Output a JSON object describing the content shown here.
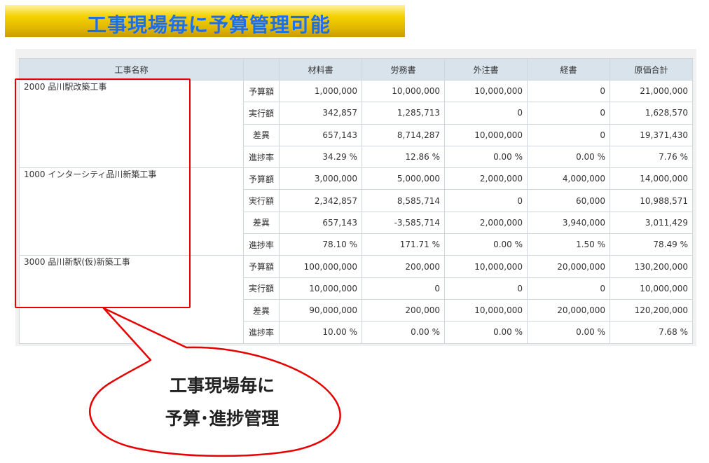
{
  "banner": {
    "title": "工事現場毎に予算管理可能"
  },
  "table": {
    "headers": [
      "工事名称",
      "",
      "材料書",
      "労務書",
      "外注書",
      "経書",
      "原価合計"
    ],
    "sites": [
      {
        "name": "2000 品川駅改築工事",
        "rows": [
          {
            "label": "予算額",
            "values": [
              "1,000,000",
              "10,000,000",
              "10,000,000",
              "0",
              "21,000,000"
            ]
          },
          {
            "label": "実行額",
            "values": [
              "342,857",
              "1,285,713",
              "0",
              "0",
              "1,628,570"
            ]
          },
          {
            "label": "差異",
            "values": [
              "657,143",
              "8,714,287",
              "10,000,000",
              "0",
              "19,371,430"
            ]
          },
          {
            "label": "進捗率",
            "values": [
              "34.29 %",
              "12.86 %",
              "0.00 %",
              "0.00 %",
              "7.76 %"
            ]
          }
        ]
      },
      {
        "name": "1000 インターシティ品川新築工事",
        "rows": [
          {
            "label": "予算額",
            "values": [
              "3,000,000",
              "5,000,000",
              "2,000,000",
              "4,000,000",
              "14,000,000"
            ]
          },
          {
            "label": "実行額",
            "values": [
              "2,342,857",
              "8,585,714",
              "0",
              "60,000",
              "10,988,571"
            ]
          },
          {
            "label": "差異",
            "values": [
              "657,143",
              "-3,585,714",
              "2,000,000",
              "3,940,000",
              "3,011,429"
            ]
          },
          {
            "label": "進捗率",
            "values": [
              "78.10 %",
              "171.71 %",
              "0.00 %",
              "1.50 %",
              "78.49 %"
            ]
          }
        ]
      },
      {
        "name": "3000 品川新駅(仮)新築工事",
        "rows": [
          {
            "label": "予算額",
            "values": [
              "100,000,000",
              "200,000",
              "10,000,000",
              "20,000,000",
              "130,200,000"
            ]
          },
          {
            "label": "実行額",
            "values": [
              "10,000,000",
              "0",
              "0",
              "0",
              "10,000,000"
            ]
          },
          {
            "label": "差異",
            "values": [
              "90,000,000",
              "200,000",
              "10,000,000",
              "20,000,000",
              "120,200,000"
            ]
          },
          {
            "label": "進捗率",
            "values": [
              "10.00 %",
              "0.00 %",
              "0.00 %",
              "0.00 %",
              "7.68 %"
            ]
          }
        ]
      }
    ]
  },
  "callout": {
    "line1": "工事現場毎に",
    "line2": "予算･進捗管理"
  },
  "colors": {
    "accent_red": "#e60000",
    "title_blue": "#1f6fe0",
    "header_bg": "#d8e3ec"
  }
}
